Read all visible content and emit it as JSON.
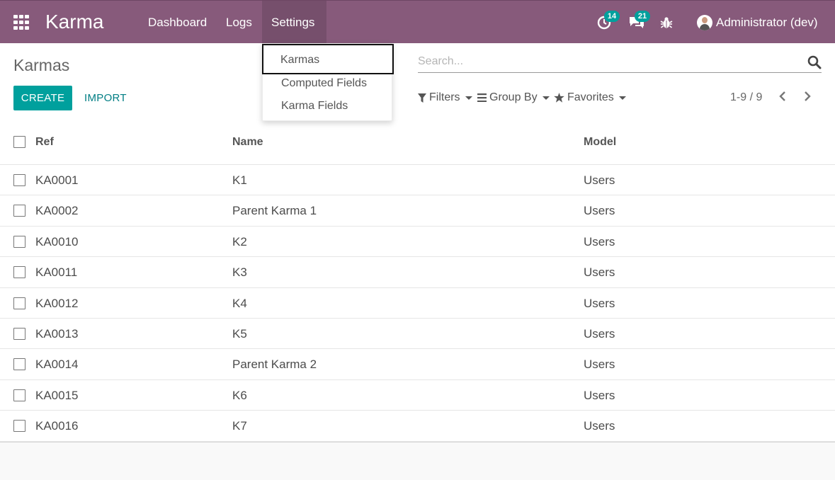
{
  "navbar": {
    "apps_icon": "grid-icon",
    "brand": "Karma",
    "menu": [
      "Dashboard",
      "Logs",
      "Settings"
    ],
    "activities_count": "14",
    "messages_count": "21",
    "user_name": "Administrator (dev)",
    "color": "#875a7b"
  },
  "settings_menu": {
    "items": [
      "Karmas",
      "Computed Fields",
      "Karma Fields"
    ]
  },
  "control_panel": {
    "breadcrumb": "Karmas",
    "create_label": "CREATE",
    "import_label": "IMPORT",
    "search_placeholder": "Search...",
    "filters_label": "Filters",
    "group_by_label": "Group By",
    "favorites_label": "Favorites",
    "pager": "1-9 / 9",
    "accent": "#00a09d"
  },
  "table": {
    "columns": [
      "Ref",
      "Name",
      "Model"
    ],
    "rows": [
      {
        "ref": "KA0001",
        "name": "K1",
        "model": "Users"
      },
      {
        "ref": "KA0002",
        "name": "Parent Karma 1",
        "model": "Users"
      },
      {
        "ref": "KA0010",
        "name": "K2",
        "model": "Users"
      },
      {
        "ref": "KA0011",
        "name": "K3",
        "model": "Users"
      },
      {
        "ref": "KA0012",
        "name": "K4",
        "model": "Users"
      },
      {
        "ref": "KA0013",
        "name": "K5",
        "model": "Users"
      },
      {
        "ref": "KA0014",
        "name": "Parent Karma 2",
        "model": "Users"
      },
      {
        "ref": "KA0015",
        "name": "K6",
        "model": "Users"
      },
      {
        "ref": "KA0016",
        "name": "K7",
        "model": "Users"
      }
    ]
  }
}
